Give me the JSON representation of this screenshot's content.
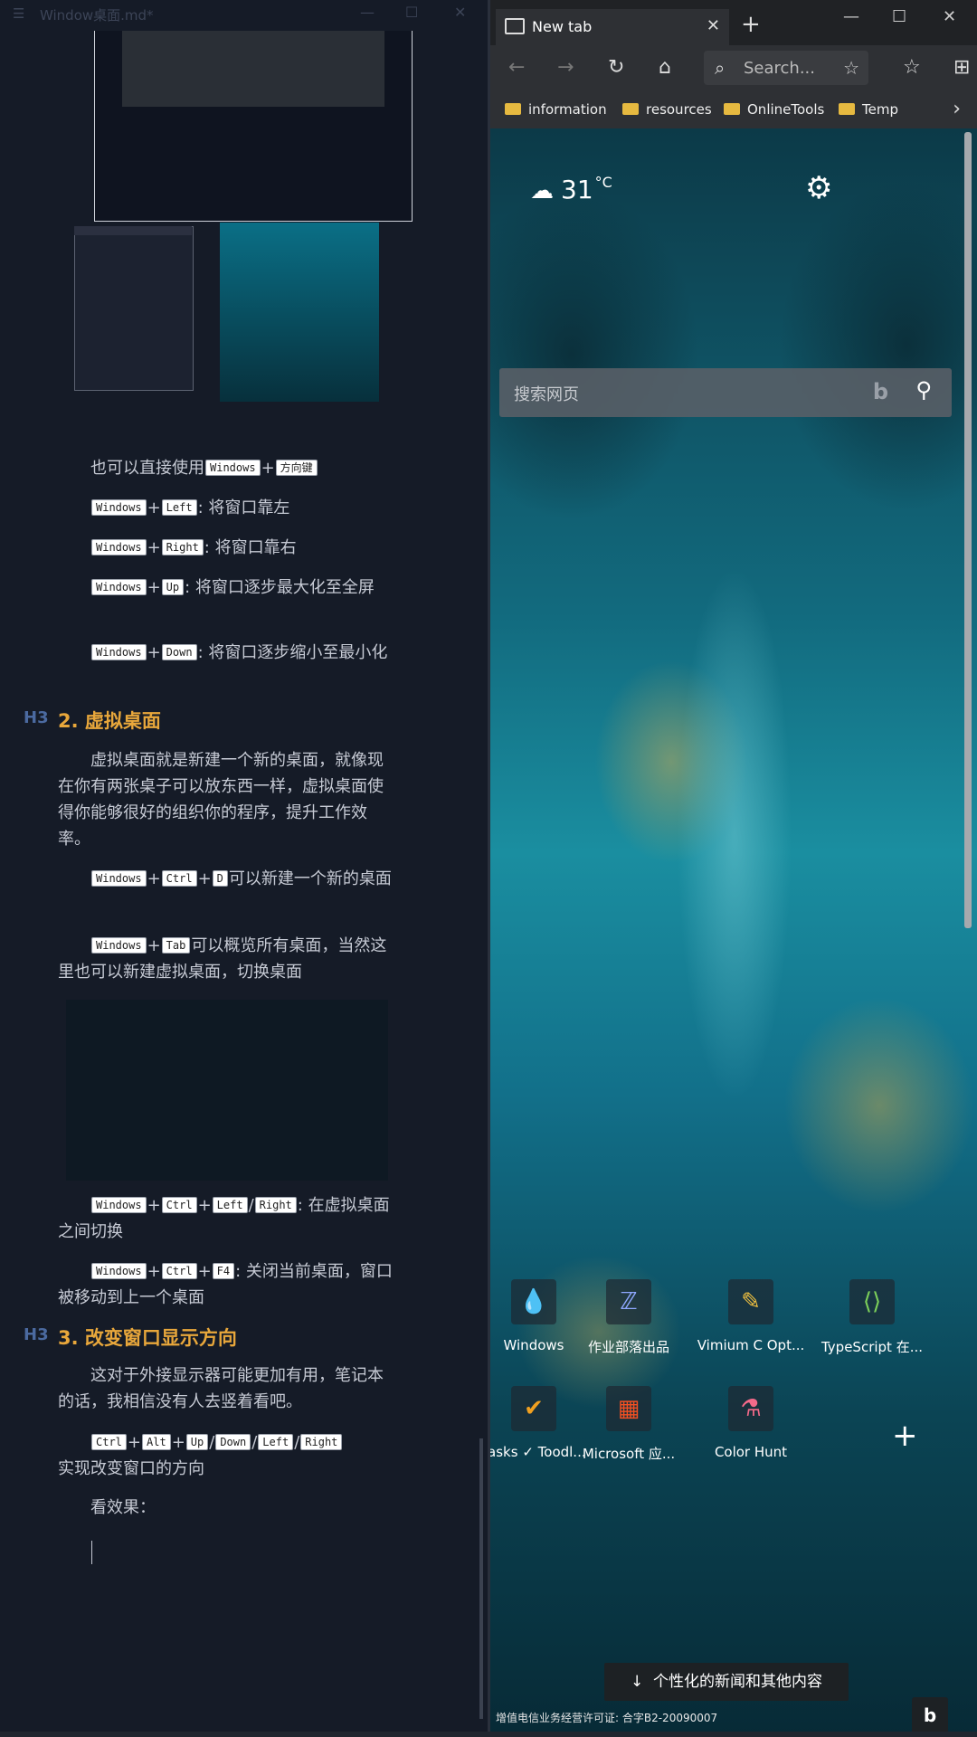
{
  "editor": {
    "title": "Window桌面.md*",
    "paragraphs": {
      "p1_text": "也可以直接使用",
      "p1_k1": "Windows",
      "p1_k2": "方向键",
      "p2_k1": "Windows",
      "p2_k2": "Left",
      "p2_text": ": 将窗口靠左",
      "p3_k1": "Windows",
      "p3_k2": "Right",
      "p3_text": ": 将窗口靠右",
      "p4_k1": "Windows",
      "p4_k2": "Up",
      "p4_text": ": 将窗口逐步最大化至全屏",
      "p5_k1": "Windows",
      "p5_k2": "Down",
      "p5_text": ": 将窗口逐步缩小至最小化",
      "p6_text": "虚拟桌面就是新建一个新的桌面，就像现在你有两张桌子可以放东西一样，虚拟桌面使得你能够很好的组织你的程序，提升工作效率。",
      "p7_k1": "Windows",
      "p7_k2": "Ctrl",
      "p7_k3": "D",
      "p7_text": "可以新建一个新的桌面",
      "p8_k1": "Windows",
      "p8_k2": "Tab",
      "p8_text": "可以概览所有桌面，当然这里也可以新建虚拟桌面，切换桌面",
      "p9_k1": "Windows",
      "p9_k2": "Ctrl",
      "p9_k3": "Left",
      "p9_k4": "Right",
      "p9_text": ": 在虚拟桌面之间切换",
      "p10_k1": "Windows",
      "p10_k2": "Ctrl",
      "p10_k3": "F4",
      "p10_text": ": 关闭当前桌面，窗口被移动到上一个桌面",
      "p11_text": "这对于外接显示器可能更加有用，笔记本的话，我相信没有人去竖着看吧。",
      "p12_k1": "Ctrl",
      "p12_k2": "Alt",
      "p12_k3": "Up",
      "p12_k4": "Down",
      "p12_k5": "Left",
      "p12_k6": "Right",
      "p12_text": "实现改变窗口的方向",
      "p13_text": "看效果："
    },
    "headings": {
      "h_tag": "H3",
      "h2": "2. 虚拟桌面",
      "h3": "3. 改变窗口显示方向"
    },
    "plus": "+",
    "slash": "/"
  },
  "browser": {
    "tab_title": "New tab",
    "search_placeholder": "Search...",
    "favorites": [
      "information",
      "resources",
      "OnlineTools",
      "Temp"
    ],
    "weather_temp": "31",
    "weather_unit": "°C",
    "bing_placeholder": "搜索网页",
    "tiles": [
      {
        "label": "Windows",
        "icon": "water-drop-icon"
      },
      {
        "label": "作业部落出品",
        "icon": "zybuluo-icon"
      },
      {
        "label": "Vimium C Opt...",
        "icon": "vimium-icon"
      },
      {
        "label": "TypeScript 在...",
        "icon": "typescript-icon"
      },
      {
        "label": "Tasks ✓ Toodl...",
        "icon": "check-icon"
      },
      {
        "label": "Microsoft 应...",
        "icon": "microsoft-icon"
      },
      {
        "label": "Color Hunt",
        "icon": "color-hunt-icon"
      }
    ],
    "news_button": "个性化的新闻和其他内容",
    "icp": "增值电信业务经营许可证: 合字B2-20090007"
  },
  "colors": {
    "editor_bg": "#151b27",
    "heading": "#e8a73b",
    "heading_tag": "#4b6aa0",
    "browser_chrome": "#2e3034"
  }
}
